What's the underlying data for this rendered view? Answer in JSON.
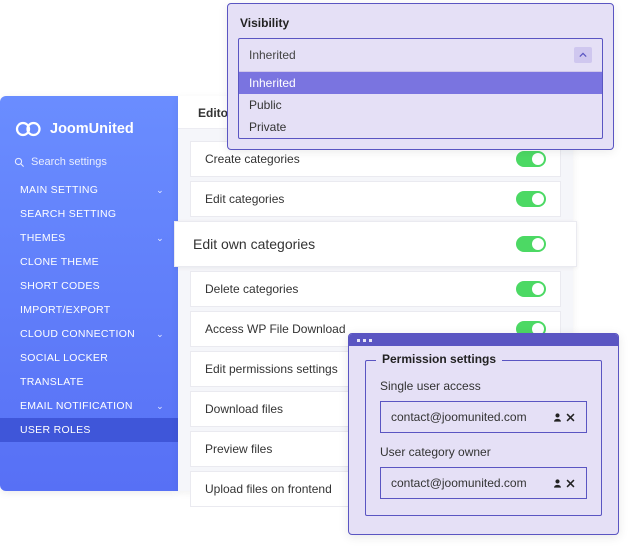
{
  "brand": "JoomUnited",
  "search_placeholder": "Search settings",
  "sidebar": {
    "items": [
      {
        "label": "MAIN SETTING",
        "expandable": true
      },
      {
        "label": "SEARCH SETTING",
        "expandable": false
      },
      {
        "label": "THEMES",
        "expandable": true
      },
      {
        "label": "CLONE THEME",
        "expandable": false
      },
      {
        "label": "SHORT CODES",
        "expandable": false
      },
      {
        "label": "IMPORT/EXPORT",
        "expandable": false
      },
      {
        "label": "CLOUD CONNECTION",
        "expandable": true
      },
      {
        "label": "SOCIAL LOCKER",
        "expandable": false
      },
      {
        "label": "TRANSLATE",
        "expandable": false
      },
      {
        "label": "EMAIL NOTIFICATION",
        "expandable": true
      },
      {
        "label": "USER ROLES",
        "expandable": false,
        "active": true
      }
    ]
  },
  "tabs": {
    "editor": "Editor"
  },
  "permissions": [
    {
      "label": "Create categories",
      "on": true
    },
    {
      "label": "Edit categories",
      "on": true
    },
    {
      "label": "Edit own categories",
      "on": true,
      "highlight": true
    },
    {
      "label": "Delete categories",
      "on": true
    },
    {
      "label": "Access WP File Download",
      "on": true
    },
    {
      "label": "Edit permissions settings",
      "on": false
    },
    {
      "label": "Download files",
      "on": false
    },
    {
      "label": "Preview files",
      "on": false
    },
    {
      "label": "Upload files on frontend",
      "on": false
    }
  ],
  "visibility": {
    "title": "Visibility",
    "selected": "Inherited",
    "options": [
      "Inherited",
      "Public",
      "Private"
    ]
  },
  "permission_settings": {
    "title": "Permission settings",
    "single_user_label": "Single user access",
    "single_user_value": "contact@joomunited.com",
    "owner_label": "User category owner",
    "owner_value": "contact@joomunited.com"
  }
}
